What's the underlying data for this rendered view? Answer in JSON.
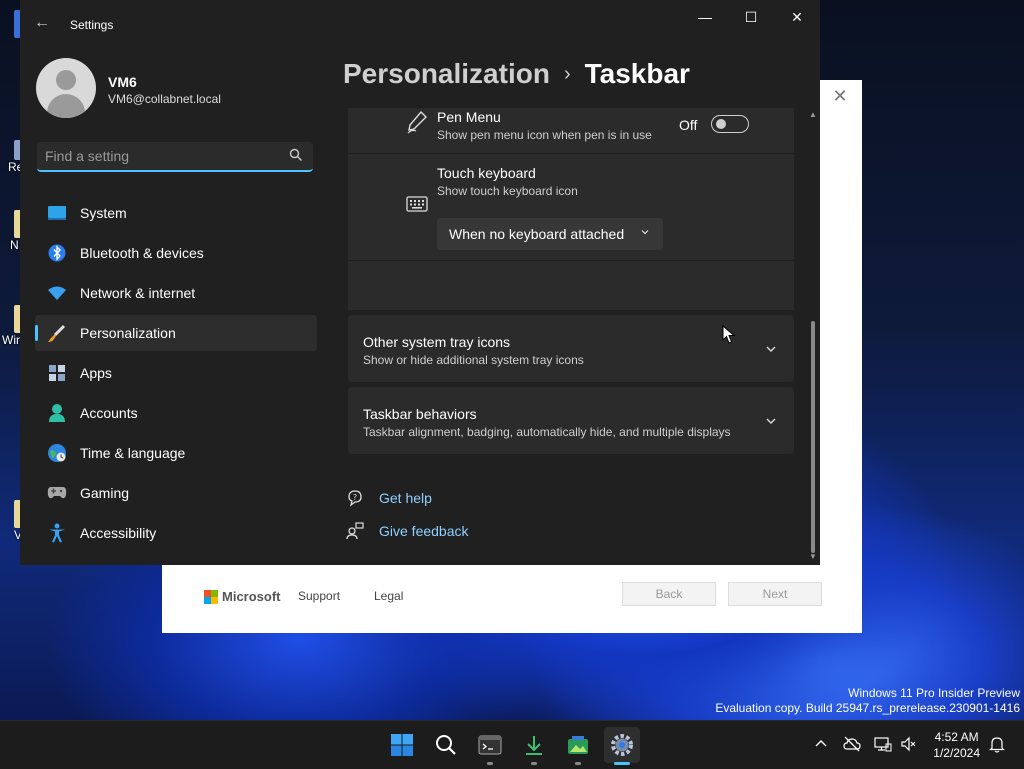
{
  "desktop": {
    "icons": [
      "Re",
      "N",
      "Wir",
      "V"
    ],
    "watermark_line1": "Windows 11 Pro Insider Preview",
    "watermark_line2": "Evaluation copy. Build 25947.rs_prerelease.230901-1416"
  },
  "setup_window": {
    "close_glyph": "✕",
    "brand": "Microsoft",
    "support": "Support",
    "legal": "Legal",
    "back": "Back",
    "next": "Next"
  },
  "settings": {
    "app_title": "Settings",
    "window_controls": {
      "minimize": "—",
      "maximize": "☐",
      "close": "✕"
    },
    "user": {
      "name": "VM6",
      "email": "VM6@collabnet.local"
    },
    "search": {
      "placeholder": "Find a setting"
    },
    "nav": [
      {
        "label": "System",
        "icon": "system-icon",
        "selected": false
      },
      {
        "label": "Bluetooth & devices",
        "icon": "bluetooth-icon",
        "selected": false
      },
      {
        "label": "Network & internet",
        "icon": "wifi-icon",
        "selected": false
      },
      {
        "label": "Personalization",
        "icon": "brush-icon",
        "selected": true
      },
      {
        "label": "Apps",
        "icon": "apps-icon",
        "selected": false
      },
      {
        "label": "Accounts",
        "icon": "person-icon",
        "selected": false
      },
      {
        "label": "Time & language",
        "icon": "globe-clock-icon",
        "selected": false
      },
      {
        "label": "Gaming",
        "icon": "gamepad-icon",
        "selected": false
      },
      {
        "label": "Accessibility",
        "icon": "accessibility-icon",
        "selected": false
      }
    ],
    "breadcrumb": {
      "parent": "Personalization",
      "separator": "›",
      "current": "Taskbar"
    },
    "pen_menu": {
      "title": "Pen Menu",
      "subtitle": "Show pen menu icon when pen is in use",
      "state": "Off"
    },
    "touch_keyboard": {
      "title": "Touch keyboard",
      "subtitle": "Show touch keyboard icon",
      "value": "When no keyboard attached"
    },
    "other_tray": {
      "title": "Other system tray icons",
      "subtitle": "Show or hide additional system tray icons"
    },
    "behaviors": {
      "title": "Taskbar behaviors",
      "subtitle": "Taskbar alignment, badging, automatically hide, and multiple displays"
    },
    "get_help": "Get help",
    "give_feedback": "Give feedback"
  },
  "taskbar": {
    "apps": [
      "start-icon",
      "search-icon",
      "terminal-icon",
      "download-icon",
      "photos-icon",
      "settings-gear-icon"
    ],
    "time": "4:52 AM",
    "date": "1/2/2024",
    "colors": {
      "accent": "#4cc2ff"
    }
  }
}
